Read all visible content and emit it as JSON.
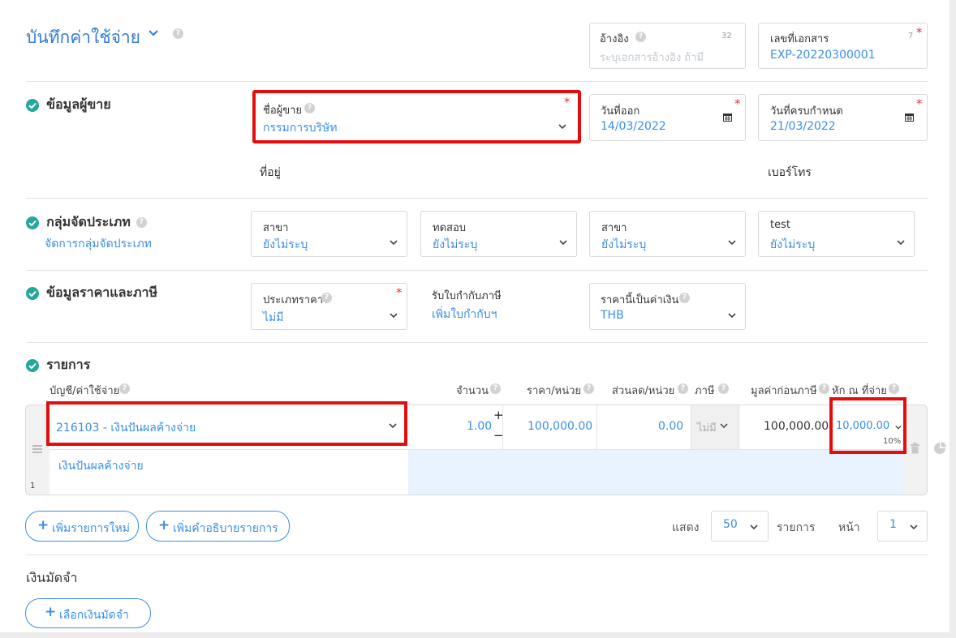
{
  "header": {
    "title": "บันทึกค่าใช้จ่าย",
    "reference": {
      "label": "อ้างอิง",
      "count": "32",
      "placeholder": "ระบุเอกสารอ้างอิง ถ้ามี"
    },
    "doc_no": {
      "label": "เลขที่เอกสาร",
      "count": "7",
      "value": "EXP-20220300001"
    }
  },
  "vendor": {
    "section_title": "ข้อมูลผู้ขาย",
    "name_label": "ชื่อผู้ขาย",
    "name_value": "กรรมการบริษัท",
    "issue_label": "วันที่ออก",
    "issue_value": "14/03/2022",
    "due_label": "วันที่ครบกำหนด",
    "due_value": "21/03/2022",
    "address_label": "ที่อยู่",
    "phone_label": "เบอร์โทร"
  },
  "category": {
    "section_title": "กลุ่มจัดประเภท",
    "manage_link": "จัดการกลุ่มจัดประเภท",
    "fields": [
      {
        "label": "สาขา",
        "value": "ยังไม่ระบุ"
      },
      {
        "label": "ทดสอบ",
        "value": "ยังไม่ระบุ"
      },
      {
        "label": "สาขา",
        "value": "ยังไม่ระบุ"
      },
      {
        "label": "test",
        "value": "ยังไม่ระบุ"
      }
    ]
  },
  "pricing": {
    "section_title": "ข้อมูลราคาและภาษี",
    "price_type_label": "ประเภทราคา",
    "price_type_value": "ไม่มี",
    "wht_label": "รับใบกำกับภาษี",
    "wht_link": "เพิ่มใบกำกับฯ",
    "currency_label": "ราคานี้เป็นค่าเงิน",
    "currency_value": "THB"
  },
  "items": {
    "section_title": "รายการ",
    "headers": {
      "account": "บัญชี/ค่าใช้จ่าย",
      "qty": "จำนวน",
      "price": "ราคา/หน่วย",
      "discount": "ส่วนลด/หน่วย",
      "tax": "ภาษี",
      "pretax": "มูลค่าก่อนภาษี",
      "wht": "หัก ณ ที่จ่าย"
    },
    "row": {
      "account": "216103 - เงินปันผลค้างจ่าย",
      "qty": "1.00",
      "price": "100,000.00",
      "discount": "0.00",
      "tax": "ไม่มี",
      "pretax": "100,000.00",
      "wht": "10,000.00",
      "wht_rate": "10%",
      "description": "เงินปันผลค้างจ่าย",
      "index": "1",
      "plus": "+",
      "minus": "−"
    },
    "add_item": "เพิ่มรายการใหม่",
    "add_desc": "เพิ่มคำอธิบายรายการ",
    "show_label": "แสดง",
    "page_size": "50",
    "items_label": "รายการ",
    "page_label": "หน้า",
    "page_value": "1"
  },
  "deposit": {
    "section_title": "เงินมัดจำ",
    "select_button": "เลือกเงินมัดจำ"
  },
  "colors": {
    "accent": "#3a8ee6",
    "check": "#25a89a",
    "highlight": "#e30d0d"
  }
}
